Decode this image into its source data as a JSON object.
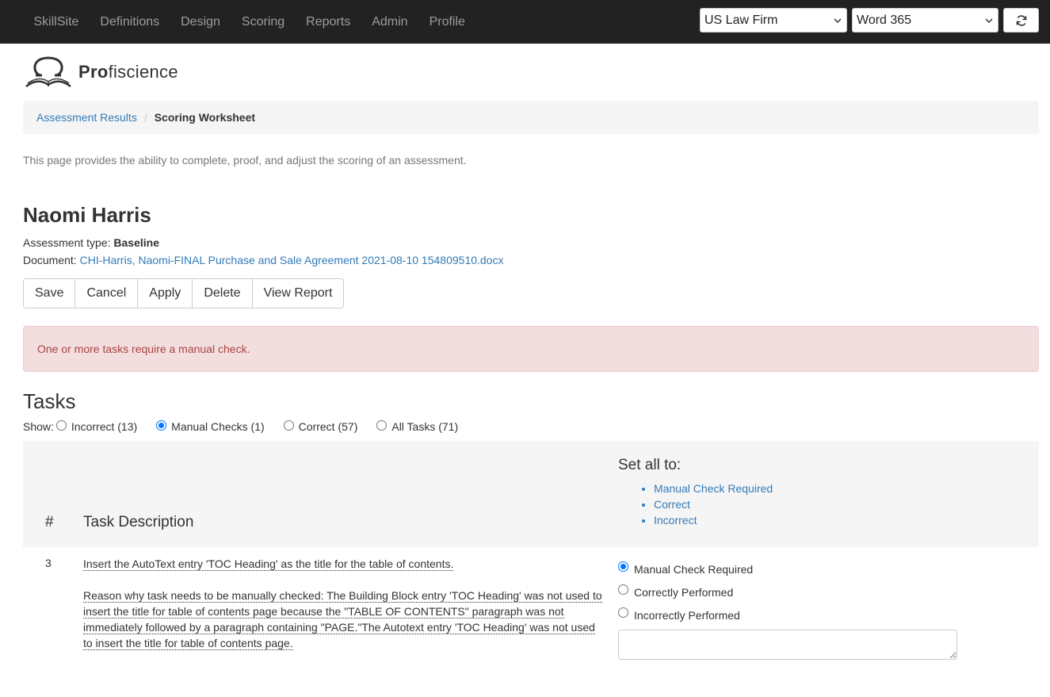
{
  "nav": {
    "items": [
      "SkillSite",
      "Definitions",
      "Design",
      "Scoring",
      "Reports",
      "Admin",
      "Profile"
    ],
    "firm_select": "US Law Firm",
    "app_select": "Word 365"
  },
  "logo": {
    "brand_bold": "Pro",
    "brand_rest": "fiscience"
  },
  "breadcrumb": {
    "link": "Assessment Results",
    "separator": "/",
    "current": "Scoring Worksheet"
  },
  "description": "This page provides the ability to complete, proof, and adjust the scoring of an assessment.",
  "person": {
    "name": "Naomi Harris",
    "assessment_type_label": "Assessment type:",
    "assessment_type": "Baseline",
    "document_label": "Document:",
    "document": "CHI-Harris, Naomi-FINAL Purchase and Sale Agreement 2021-08-10 154809510.docx"
  },
  "actions": {
    "save": "Save",
    "cancel": "Cancel",
    "apply": "Apply",
    "delete": "Delete",
    "view_report": "View Report"
  },
  "alert": "One or more tasks require a manual check.",
  "tasks": {
    "heading": "Tasks",
    "show_label": "Show:",
    "filters": [
      {
        "label": "Incorrect (13)",
        "selected": false
      },
      {
        "label": "Manual Checks (1)",
        "selected": true
      },
      {
        "label": "Correct (57)",
        "selected": false
      },
      {
        "label": "All Tasks (71)",
        "selected": false
      }
    ]
  },
  "table": {
    "col_num": "#",
    "col_desc": "Task Description",
    "set_all_title": "Set all to:",
    "set_all_options": [
      "Manual Check Required",
      "Correct",
      "Incorrect"
    ],
    "rows": [
      {
        "num": "3",
        "task": "Insert the AutoText entry 'TOC Heading' as the title for the table of contents.",
        "reason": "Reason why task needs to be manually checked: The Building Block entry 'TOC Heading' was not used to insert the title for table of contents page because the \"TABLE OF CONTENTS\" paragraph was not immediately followed by a paragraph containing \"PAGE.\"The Autotext entry 'TOC Heading' was not used to insert the title for table of contents page.",
        "options": [
          {
            "label": "Manual Check Required",
            "selected": true
          },
          {
            "label": "Correctly Performed",
            "selected": false
          },
          {
            "label": "Incorrectly Performed",
            "selected": false
          }
        ]
      }
    ]
  },
  "colors": {
    "navbar": "#222222",
    "link": "#337ab7",
    "alert_bg": "#f2dede",
    "alert_text": "#a94442",
    "radio_on": "#0075ff"
  }
}
